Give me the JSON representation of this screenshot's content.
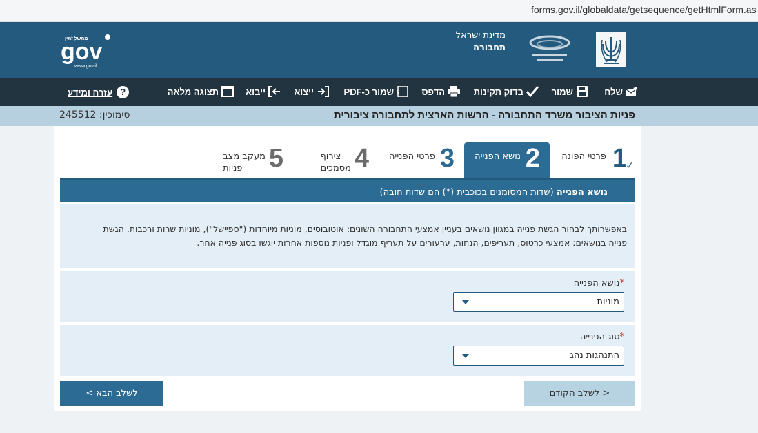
{
  "browser": {
    "url": "forms.gov.il/globaldata/getsequence/getHtmlForm.as"
  },
  "header": {
    "state_name": "מדינת ישראל",
    "ministry_short": "תחבורה",
    "ministry_logo_text": "משרד התחבורה והבטיחות בדרכים",
    "gov_logo_text": "gov",
    "gov_logo_sub": "ממשל זמין",
    "gov_logo_url": "www.gov.il"
  },
  "toolbar": {
    "send": "שלח",
    "save": "שמור",
    "check_validity": "בדוק תקינות",
    "print": "הדפס",
    "save_pdf": "שמור כ-PDF",
    "export": "ייצוא",
    "import": "ייבוא",
    "full_view": "תצוגה מלאה",
    "help": "עזרה ומידע"
  },
  "title_bar": {
    "title": "פניות הציבור משרד התחבורה - הרשות הארצית לתחבורה ציבורית",
    "reference": "סימוכין: 245512"
  },
  "steps": [
    {
      "number": "1",
      "label": "פרטי הפונה",
      "state": "completed"
    },
    {
      "number": "2",
      "label": "נושא הפנייה",
      "state": "active"
    },
    {
      "number": "3",
      "label": "פרטי הפנייה",
      "state": "pending"
    },
    {
      "number": "4",
      "label_line1": "צירוף",
      "label_line2": "מסמכים",
      "state": "pending"
    },
    {
      "number": "5",
      "label_line1": "מעקב מצב",
      "label_line2": "פניות",
      "state": "pending"
    }
  ],
  "section": {
    "title": "נושא הפנייה",
    "note": "(שדות המסומנים בכוכבית (*) הם שדות חובה)"
  },
  "info_text": "באפשרותך לבחור הגשת פנייה במגוון נושאים בעניין אמצעי התחבורה השונים: אוטובוסים, מוניות מיוחדות (\"ספיישל\"), מוניות שרות ורכבות. הגשת פנייה בנושאים: אמצעי כרטוס, תעריפים, הנחות, ערעורים על תעריף מוגדל ופניות נוספות אחרות יוגשו בסוג פנייה אחר.",
  "fields": {
    "subject": {
      "label": "נושא הפנייה",
      "required_mark": "*",
      "value": "מוניות"
    },
    "type": {
      "label": "סוג הפנייה",
      "required_mark": "*",
      "value": "התנהגות נהג"
    }
  },
  "buttons": {
    "previous": "< לשלב הקודם",
    "next": "לשלב הבא >"
  },
  "colors": {
    "header_blue": "#235a7d",
    "toolbar_dark": "#22343f",
    "active_step": "#2c6b93",
    "light_panel": "#e3eef6",
    "title_bar": "#b7d0e0",
    "required_red": "#c0392b"
  }
}
